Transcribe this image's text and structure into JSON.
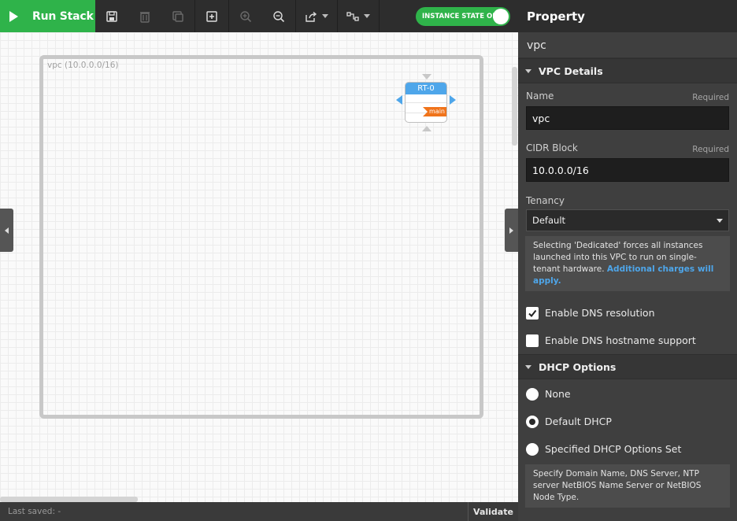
{
  "toolbar": {
    "run_label": "Run Stack",
    "instance_state_label": "INSTANCE STATE ON",
    "buttons": [
      "save-icon",
      "delete-icon",
      "duplicate-icon",
      "add-icon",
      "zoom-in-icon",
      "zoom-out-icon",
      "export-icon",
      "connection-style-icon"
    ]
  },
  "canvas": {
    "vpc_label": "vpc (10.0.0.0/16)",
    "route_table": {
      "name": "RT-0",
      "tag": "main"
    }
  },
  "statusbar": {
    "last_saved": "Last saved: -",
    "validate_label": "Validate"
  },
  "panel": {
    "title": "Property",
    "resource_name": "vpc",
    "vpc_details": {
      "section_label": "VPC Details",
      "name_label": "Name",
      "name_required": "Required",
      "name_value": "vpc",
      "cidr_label": "CIDR Block",
      "cidr_required": "Required",
      "cidr_value": "10.0.0.0/16",
      "tenancy_label": "Tenancy",
      "tenancy_value": "Default",
      "tenancy_note": "Selecting 'Dedicated' forces all instances launched into this VPC to run on single-tenant hardware.",
      "tenancy_note_link": "Additional charges will apply.",
      "dns_resolution_label": "Enable DNS resolution",
      "dns_resolution_checked": true,
      "dns_hostname_label": "Enable DNS hostname support",
      "dns_hostname_checked": false
    },
    "dhcp_options": {
      "section_label": "DHCP Options",
      "option_none": "None",
      "option_default": "Default DHCP",
      "option_specified": "Specified DHCP Options Set",
      "selected": "Default DHCP",
      "note": "Specify Domain Name, DNS Server, NTP server NetBIOS Name Server or NetBIOS Node Type."
    }
  },
  "colors": {
    "accent_green": "#2fb34a",
    "node_blue": "#4ea6ea",
    "tag_orange": "#f0731a",
    "link_blue": "#4ea6ea"
  }
}
